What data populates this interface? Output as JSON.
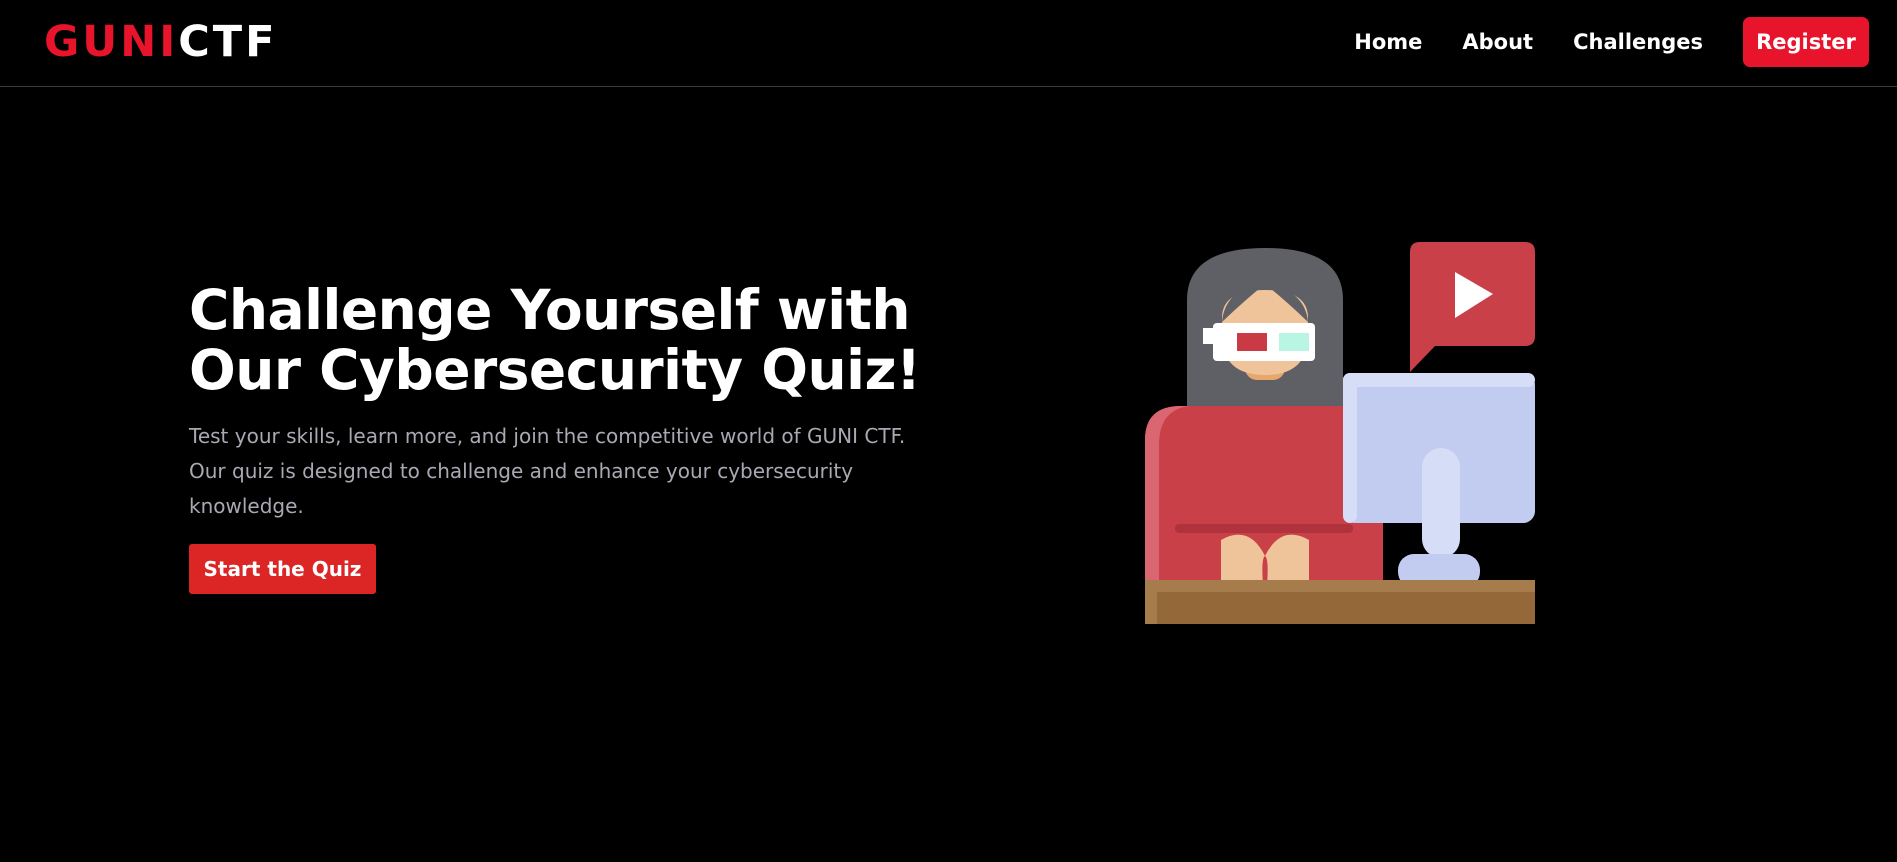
{
  "brand": {
    "logo_part1": "GUNI",
    "logo_part2": "CTF"
  },
  "nav": {
    "links": [
      {
        "label": "Home"
      },
      {
        "label": "About"
      },
      {
        "label": "Challenges"
      }
    ],
    "register_label": "Register"
  },
  "hero": {
    "title_line1": "Challenge Yourself with",
    "title_line2": "Our Cybersecurity Quiz!",
    "description": "Test your skills, learn more, and join the competitive world of GUNI CTF. Our quiz is designed to challenge and enhance your cybersecurity knowledge.",
    "cta_label": "Start the Quiz"
  },
  "colors": {
    "background": "#000000",
    "accent": "#e8142c",
    "cta": "#dc2626",
    "muted_text": "#a9a9b3"
  },
  "icons": {
    "illustration": "woman-at-computer-video-illustration"
  }
}
